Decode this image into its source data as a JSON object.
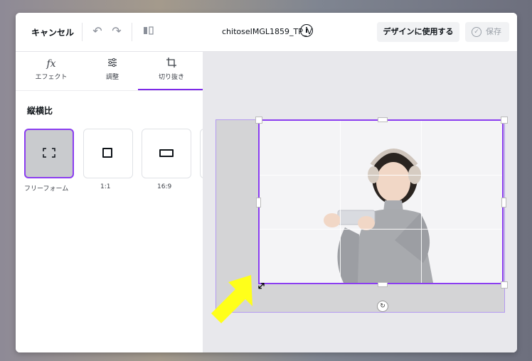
{
  "topbar": {
    "cancel_label": "キャンセル",
    "undo_icon": "undo-icon",
    "redo_icon": "redo-icon",
    "flip_icon": "flip-icon",
    "filename": "chitoseIMGL1859_TP_V",
    "info_icon": "info-icon",
    "use_in_design_label": "デザインに使用する",
    "save_label": "保存"
  },
  "panel": {
    "tabs": [
      {
        "icon": "fx",
        "label": "エフェクト"
      },
      {
        "icon": "adjust-icon",
        "label": "調整"
      },
      {
        "icon": "crop-icon",
        "label": "切り抜き"
      }
    ],
    "active_tab": "切り抜き",
    "section_title": "縦横比",
    "ratios": [
      {
        "label": "フリーフォーム",
        "selected": true
      },
      {
        "label": "1:1",
        "selected": false
      },
      {
        "label": "16:9",
        "selected": false
      }
    ]
  },
  "colors": {
    "accent": "#8b3df0",
    "arrow": "#ffff1a"
  }
}
